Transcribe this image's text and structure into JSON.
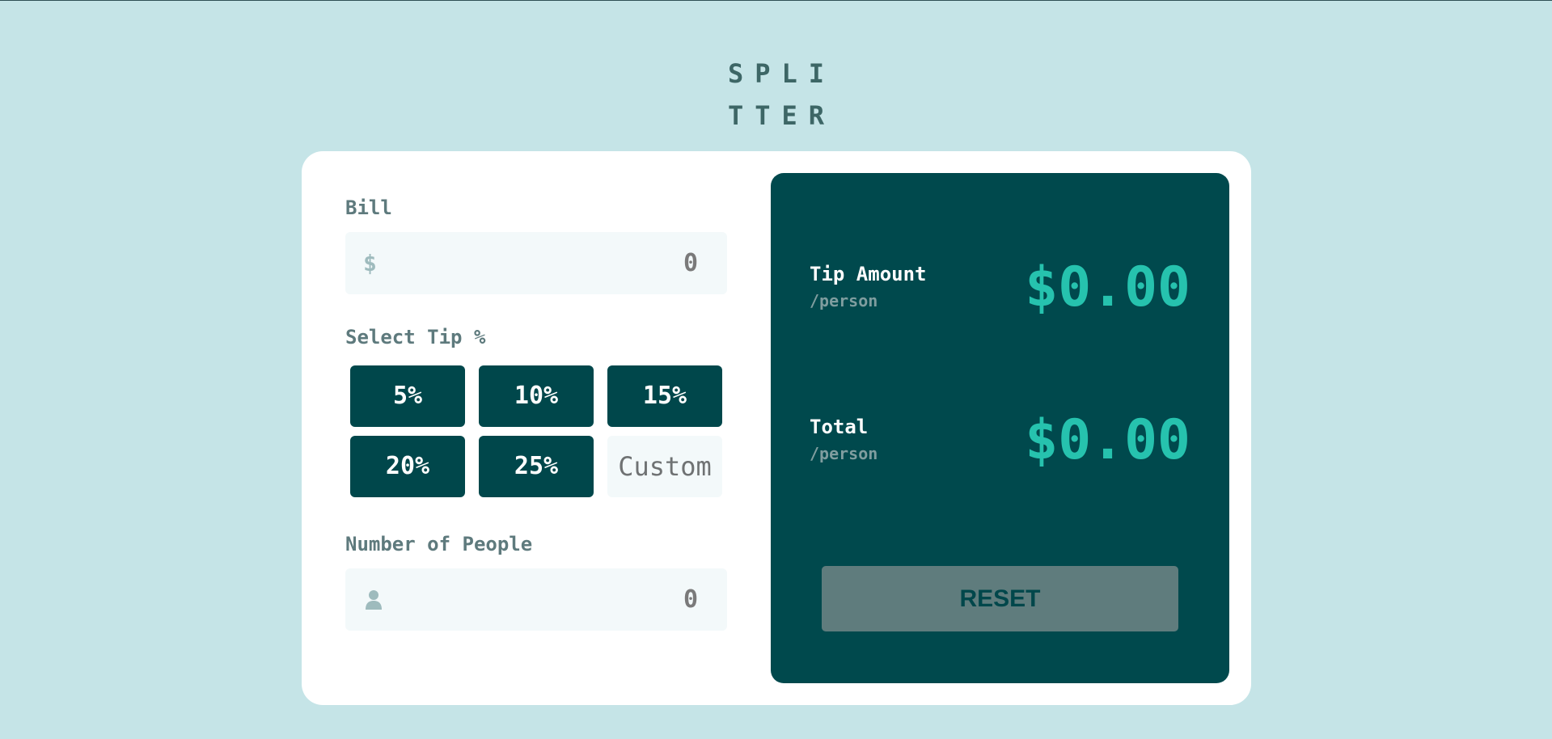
{
  "logo": {
    "line1": "SPLI",
    "line2": "TTER"
  },
  "bill": {
    "label": "Bill",
    "currency_symbol": "$",
    "value": "0"
  },
  "tip": {
    "label": "Select Tip %",
    "options": [
      "5%",
      "10%",
      "15%",
      "20%",
      "25%"
    ],
    "custom_placeholder": "Custom"
  },
  "people": {
    "label": "Number of People",
    "icon": "person-icon",
    "value": "0"
  },
  "results": {
    "tip_amount": {
      "label": "Tip Amount",
      "sub": "/person",
      "value": "$0.00"
    },
    "total": {
      "label": "Total",
      "sub": "/person",
      "value": "$0.00"
    },
    "reset_label": "RESET"
  },
  "colors": {
    "background": "#c5e4e7",
    "dark_cyan": "#00474b",
    "accent": "#26c2ae",
    "reset_disabled": "#5f7c7d"
  }
}
